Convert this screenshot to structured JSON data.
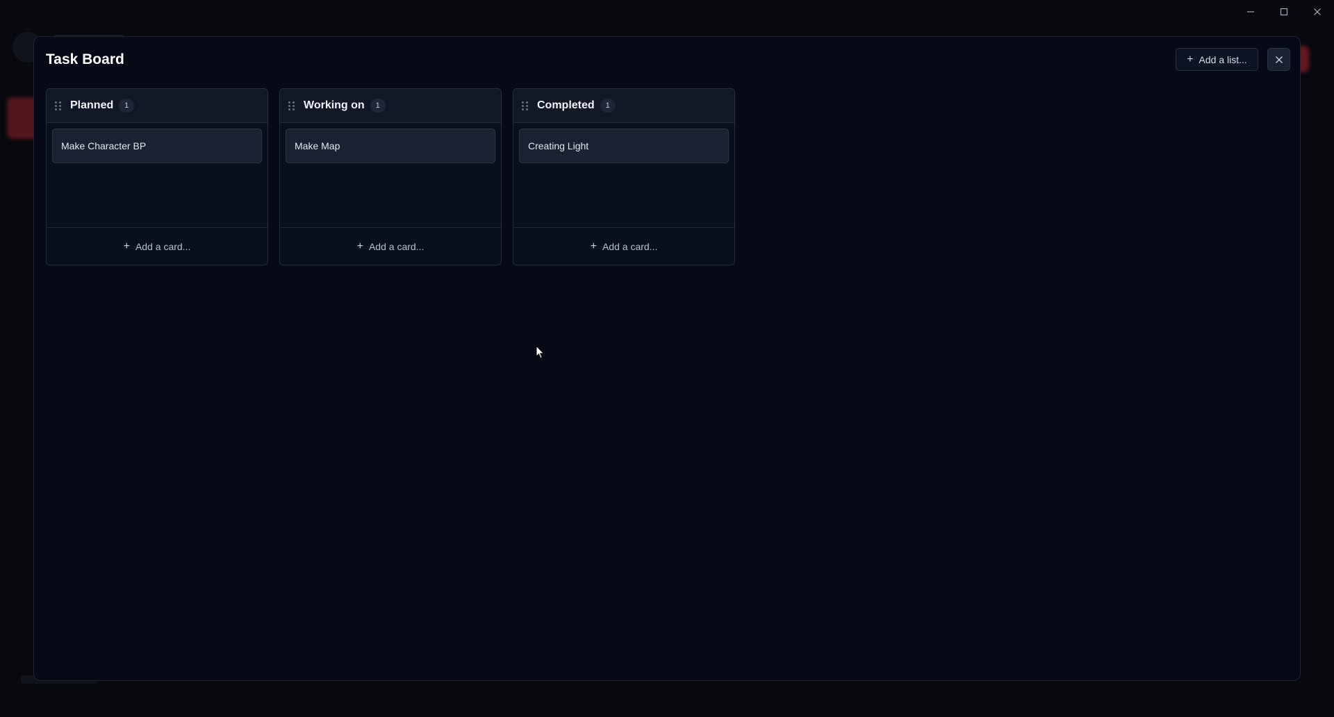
{
  "window": {
    "minimize_icon": "minimize-icon",
    "maximize_icon": "maximize-icon",
    "close_icon": "close-icon"
  },
  "board": {
    "title": "Task Board",
    "add_list_label": "Add a list...",
    "lists": [
      {
        "name": "Planned",
        "count": "1",
        "cards": [
          "Make Character BP"
        ],
        "add_card_label": "Add a card..."
      },
      {
        "name": "Working on",
        "count": "1",
        "cards": [
          "Make Map"
        ],
        "add_card_label": "Add a card..."
      },
      {
        "name": "Completed",
        "count": "1",
        "cards": [
          "Creating Light"
        ],
        "add_card_label": "Add a card..."
      }
    ]
  },
  "colors": {
    "background": "#07090e",
    "modal_bg": "#060a16",
    "card_bg": "#1a2130",
    "accent_red": "#7a1d24"
  }
}
